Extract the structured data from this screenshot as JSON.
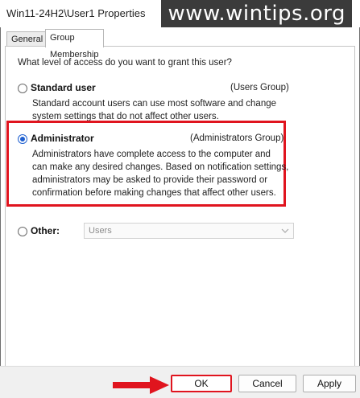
{
  "window": {
    "title": "Win11-24H2\\User1 Properties",
    "watermark": "www.wintips.org"
  },
  "tabs": [
    {
      "label": "General",
      "active": false
    },
    {
      "label": "Group Membership",
      "active": true
    }
  ],
  "question": "What level of access do you want to grant this user?",
  "options": {
    "standard": {
      "label": "Standard user",
      "group": "(Users Group)",
      "desc": [
        "Standard account users can use most software and change",
        "system settings that do not affect other users."
      ],
      "checked": false
    },
    "administrator": {
      "label": "Administrator",
      "group": "(Administrators Group)",
      "desc": [
        "Administrators have complete access to the computer and",
        "can make any desired changes. Based on notification settings,",
        "administrators may be asked to provide their password or",
        "confirmation before making changes that affect other users."
      ],
      "checked": true
    },
    "other": {
      "label": "Other:",
      "select_value": "Users",
      "checked": false
    }
  },
  "buttons": {
    "ok": "OK",
    "cancel": "Cancel",
    "apply": "Apply"
  },
  "colors": {
    "highlight": "#e0141e",
    "radio_accent": "#1e5fd0"
  }
}
